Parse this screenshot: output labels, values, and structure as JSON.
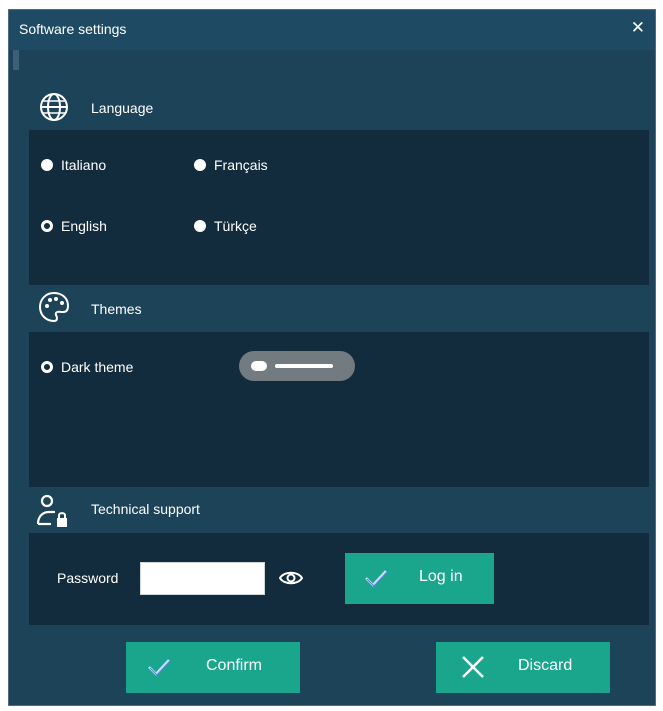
{
  "window": {
    "title": "Software settings",
    "close_glyph": "✕"
  },
  "language": {
    "heading": "Language",
    "icon": "globe-icon",
    "options": [
      {
        "label": "Italiano",
        "selected": false
      },
      {
        "label": "Français",
        "selected": false
      },
      {
        "label": "English",
        "selected": true
      },
      {
        "label": "Türkçe",
        "selected": false
      }
    ]
  },
  "themes": {
    "heading": "Themes",
    "icon": "palette-icon",
    "dark_theme_label": "Dark theme",
    "dark_theme_selected": true,
    "toggle_on": false
  },
  "support": {
    "heading": "Technical support",
    "icon": "user-lock-icon",
    "password_label": "Password",
    "password_value": "",
    "login_label": "Log in"
  },
  "footer": {
    "confirm_label": "Confirm",
    "discard_label": "Discard"
  },
  "colors": {
    "window_bg": "#1d4359",
    "panel_bg": "#132c3d",
    "accent": "#1aa58d",
    "toggle": "#727b80"
  }
}
